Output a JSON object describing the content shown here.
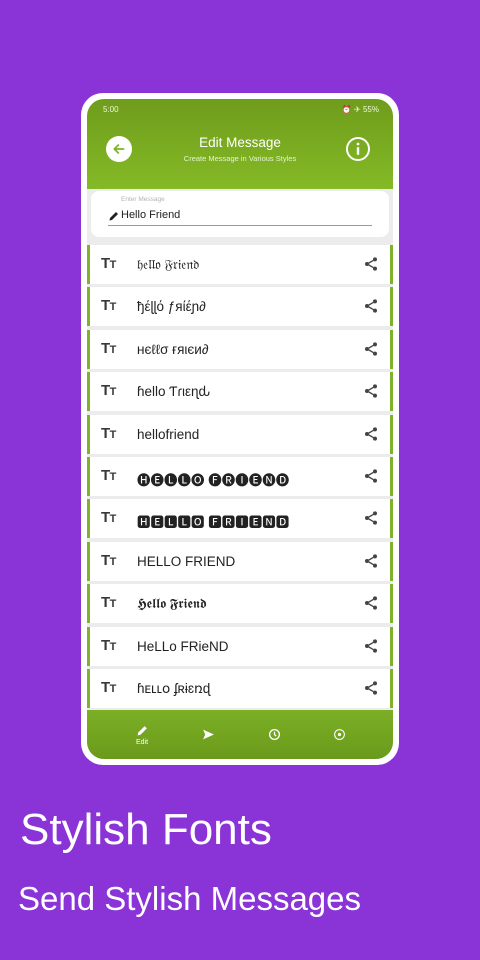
{
  "status_bar": {
    "time": "5:00",
    "right": "⏰ ✈ 55%"
  },
  "header": {
    "title": "Edit Message",
    "subtitle": "Create Message in Various Styles",
    "back_icon": "arrow-left-icon",
    "info_icon": "info-icon"
  },
  "input": {
    "label": "Enter Message",
    "value": "Hello Friend"
  },
  "styles": [
    "𝔥𝔢𝔩𝔩𝔬 𝔉𝔯𝔦𝔢𝔫𝔡",
    "ђέɭɭό ƒяίέɲ∂",
    "ʜєℓℓσ ғяιєи∂",
    "ɦello Ƭɾιεɳԃ",
    "hellofriend",
    "🅗🅔🅛🅛🅞 🅕🅡🅘🅔🅝🅓",
    "🅷🅴🅻🅻🅾 🅵🆁🅸🅴🅽🅳",
    "HELLO FRIEND",
    "𝕳𝖊𝖑𝖑𝖔 𝕱𝖗𝖎𝖊𝖓𝖉",
    "HeLLo FRieND",
    "ɦᴇʟʟօ ʄʀɨɛռɖ"
  ],
  "bottom_nav": [
    {
      "label": "Edit",
      "icon": "pencil-icon"
    },
    {
      "label": "",
      "icon": "send-icon"
    },
    {
      "label": "",
      "icon": "history-icon"
    },
    {
      "label": "",
      "icon": "settings-icon"
    }
  ],
  "promo": {
    "title": "Stylish Fonts",
    "subtitle": "Send Stylish Messages"
  },
  "colors": {
    "background": "#8a33d6",
    "accent": "#7fb22a"
  }
}
